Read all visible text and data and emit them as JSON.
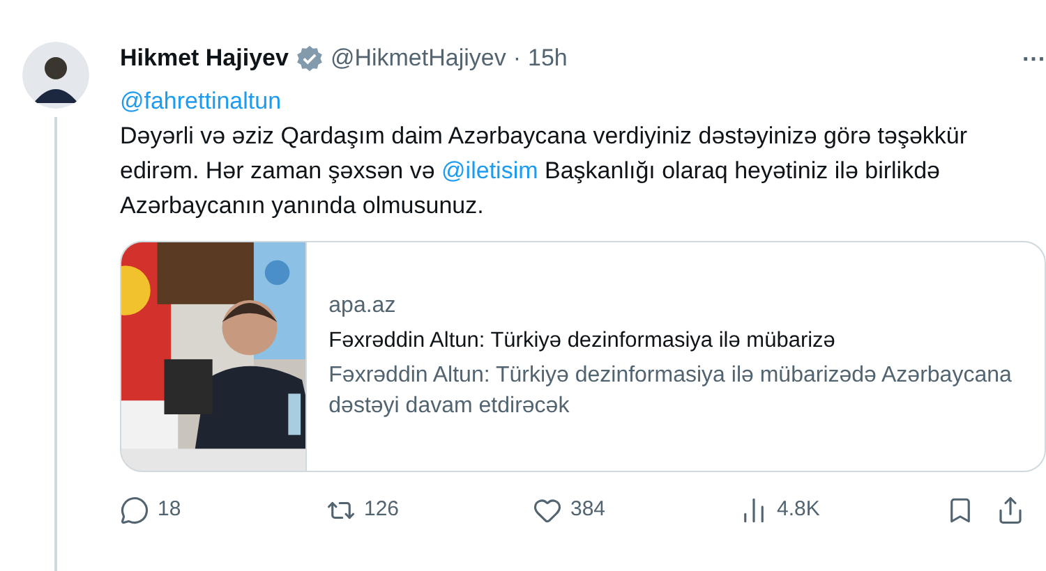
{
  "author": {
    "name": "Hikmet Hajiyev",
    "verified": true,
    "handle": "@HikmetHajiyev",
    "separator": "·",
    "time": "15h"
  },
  "more_button": "···",
  "reply_to": "@fahrettinaltun",
  "body": [
    {
      "kind": "text",
      "text": "Dəyərli və əziz Qardaşım daim Azərbaycana verdiyiniz dəstəyinizə görə təşəkkür edirəm. Hər zaman şəxsən və "
    },
    {
      "kind": "mention",
      "text": "@iletisim"
    },
    {
      "kind": "text",
      "text": " Başkanlığı olaraq heyətiniz ilə birlikdə Azərbaycanın yanında olmusunuz."
    }
  ],
  "link_card": {
    "domain": "apa.az",
    "title": "Fəxrəddin Altun: Türkiyə dezinformasiya ilə mübarizə",
    "description": "Fəxrəddin Altun: Türkiyə dezinformasiya ilə mübarizədə Azərbaycana dəstəyi davam etdirəcək"
  },
  "actions": [
    {
      "kind": "reply",
      "count": "18"
    },
    {
      "kind": "retweet",
      "count": "126"
    },
    {
      "kind": "like",
      "count": "384"
    },
    {
      "kind": "views",
      "count": "4.8K"
    },
    {
      "kind": "bookmark"
    },
    {
      "kind": "share"
    }
  ]
}
